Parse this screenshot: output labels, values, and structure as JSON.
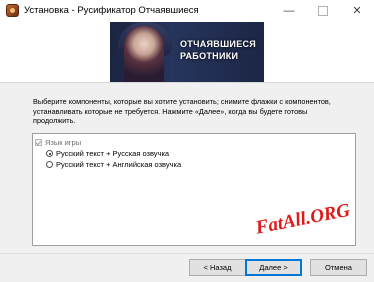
{
  "window": {
    "title": "Установка - Русификатор Отчаявшиеся",
    "minimize_glyph": "—",
    "close_glyph": "✕",
    "icon": "installer-app-icon"
  },
  "banner": {
    "title_line1": "ОТЧАЯВШИЕСЯ",
    "title_line2": "РАБОТНИКИ"
  },
  "description": "Выберите компоненты, которые вы хотите установить; снимите флажки с компонентов, устанавливать которые не требуется. Нажмите «Далее», когда вы будете готовы продолжить.",
  "components": {
    "group_label": "Язык игры",
    "group_checked": true,
    "options": [
      {
        "label": "Русский текст + Русская озвучка",
        "selected": true
      },
      {
        "label": "Русский текст + Английская озвучка",
        "selected": false
      }
    ]
  },
  "watermark": "FatAll.ORG",
  "buttons": {
    "back": "< Назад",
    "next": "Далее >",
    "cancel": "Отмена"
  },
  "colors": {
    "focus_border": "#0078d7",
    "watermark": "#e01818"
  }
}
